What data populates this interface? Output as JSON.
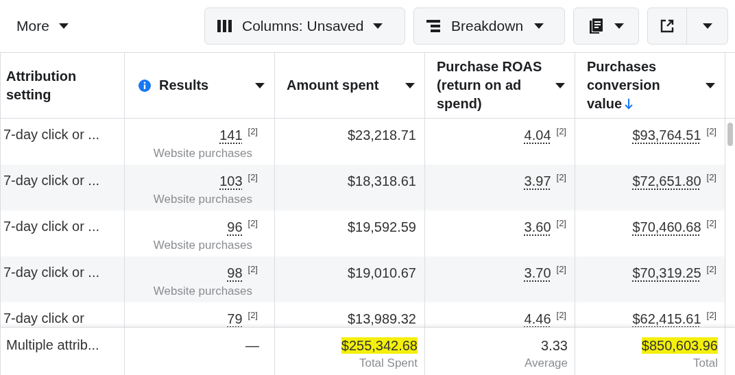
{
  "toolbar": {
    "more": {
      "label": "More"
    },
    "buttons": [
      {
        "kind": "columns",
        "label": "Columns: Unsaved"
      },
      {
        "kind": "breakdown",
        "label": "Breakdown"
      },
      {
        "kind": "reports"
      },
      {
        "kind": "export"
      }
    ]
  },
  "table": {
    "columns": [
      {
        "label": "Attribution setting",
        "info": false,
        "menu": false,
        "sorted": false
      },
      {
        "label": "Results",
        "info": true,
        "menu": true,
        "sorted": false
      },
      {
        "label": "Amount spent",
        "info": false,
        "menu": true,
        "sorted": false
      },
      {
        "label": "Purchase ROAS (return on ad spend)",
        "info": false,
        "menu": true,
        "sorted": false
      },
      {
        "label": "Purchases conversion value",
        "info": false,
        "menu": true,
        "sorted": true
      }
    ],
    "rows": [
      {
        "attribution": "7-day click or ...",
        "results": "141",
        "results_note": "[2]",
        "results_type": "Website purchases",
        "amount": "$23,218.71",
        "roas": "4.04",
        "roas_note": "[2]",
        "value": "$93,764.51",
        "value_note": "[2]"
      },
      {
        "attribution": "7-day click or ...",
        "results": "103",
        "results_note": "[2]",
        "results_type": "Website purchases",
        "amount": "$18,318.61",
        "roas": "3.97",
        "roas_note": "[2]",
        "value": "$72,651.80",
        "value_note": "[2]"
      },
      {
        "attribution": "7-day click or ...",
        "results": "96",
        "results_note": "[2]",
        "results_type": "Website purchases",
        "amount": "$19,592.59",
        "roas": "3.60",
        "roas_note": "[2]",
        "value": "$70,460.68",
        "value_note": "[2]"
      },
      {
        "attribution": "7-day click or ...",
        "results": "98",
        "results_note": "[2]",
        "results_type": "Website purchases",
        "amount": "$19,010.67",
        "roas": "3.70",
        "roas_note": "[2]",
        "value": "$70,319.25",
        "value_note": "[2]"
      },
      {
        "attribution": "7-day click or",
        "results": "79",
        "results_note": "[2]",
        "amount": "$13,989.32",
        "roas": "4.46",
        "roas_note": "[2]",
        "value": "$62,415.61",
        "value_note": "[2]"
      }
    ],
    "totals": {
      "attribution": "Multiple attrib...",
      "results": "—",
      "amount": {
        "text": "$255,342.68",
        "caption": "Total Spent",
        "highlighted": true
      },
      "roas": {
        "text": "3.33",
        "caption": "Average",
        "highlighted": false
      },
      "value": {
        "text": "$850,603.96",
        "caption": "Total",
        "highlighted": true
      }
    }
  }
}
